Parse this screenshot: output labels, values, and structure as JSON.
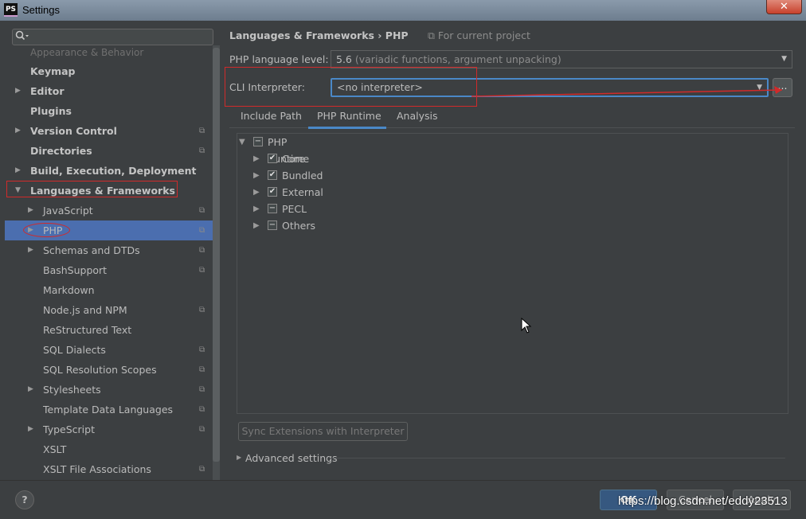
{
  "window": {
    "title": "Settings",
    "logo_text": "PS",
    "close_glyph": "✕"
  },
  "search": {
    "icon": "search-icon",
    "placeholder": ""
  },
  "sidebar": {
    "faded_item": "Appearance & Behavior",
    "items": [
      {
        "label": "Keymap",
        "bold": true,
        "arrow": "",
        "project": false
      },
      {
        "label": "Editor",
        "bold": true,
        "arrow": "▶",
        "project": false
      },
      {
        "label": "Plugins",
        "bold": true,
        "arrow": "",
        "project": false
      },
      {
        "label": "Version Control",
        "bold": true,
        "arrow": "▶",
        "project": true
      },
      {
        "label": "Directories",
        "bold": true,
        "arrow": "",
        "project": true
      },
      {
        "label": "Build, Execution, Deployment",
        "bold": true,
        "arrow": "▶",
        "project": false
      },
      {
        "label": "Languages & Frameworks",
        "bold": true,
        "arrow": "▼",
        "project": false
      },
      {
        "label": "JavaScript",
        "bold": false,
        "arrow": "▶",
        "project": true
      },
      {
        "label": "PHP",
        "bold": false,
        "arrow": "▶",
        "project": true,
        "selected": true
      },
      {
        "label": "Schemas and DTDs",
        "bold": false,
        "arrow": "▶",
        "project": true
      },
      {
        "label": "BashSupport",
        "bold": false,
        "arrow": "",
        "project": true
      },
      {
        "label": "Markdown",
        "bold": false,
        "arrow": "",
        "project": false
      },
      {
        "label": "Node.js and NPM",
        "bold": false,
        "arrow": "",
        "project": true
      },
      {
        "label": "ReStructured Text",
        "bold": false,
        "arrow": "",
        "project": false
      },
      {
        "label": "SQL Dialects",
        "bold": false,
        "arrow": "",
        "project": true
      },
      {
        "label": "SQL Resolution Scopes",
        "bold": false,
        "arrow": "",
        "project": true
      },
      {
        "label": "Stylesheets",
        "bold": false,
        "arrow": "▶",
        "project": true
      },
      {
        "label": "Template Data Languages",
        "bold": false,
        "arrow": "",
        "project": true
      },
      {
        "label": "TypeScript",
        "bold": false,
        "arrow": "▶",
        "project": true
      },
      {
        "label": "XSLT",
        "bold": false,
        "arrow": "",
        "project": false
      },
      {
        "label": "XSLT File Associations",
        "bold": false,
        "arrow": "",
        "project": true
      }
    ]
  },
  "header": {
    "breadcrumb": "Languages & Frameworks  ›  PHP",
    "scope_hint": "⧉ For current project"
  },
  "php_level": {
    "label": "PHP language level:",
    "version": "5.6",
    "description": "(variadic functions, argument unpacking)"
  },
  "cli": {
    "label": "CLI Interpreter:",
    "value": "<no interpreter>",
    "browse_label": "..."
  },
  "tabs": [
    {
      "label": "Include Path",
      "active": false
    },
    {
      "label": "PHP Runtime",
      "active": true
    },
    {
      "label": "Analysis",
      "active": false
    }
  ],
  "runtime": {
    "root": {
      "label": "PHP Runtime",
      "state": "partial"
    },
    "children": [
      {
        "label": "Core",
        "state": "checked"
      },
      {
        "label": "Bundled",
        "state": "checked"
      },
      {
        "label": "External",
        "state": "checked"
      },
      {
        "label": "PECL",
        "state": "partial"
      },
      {
        "label": "Others",
        "state": "partial"
      }
    ]
  },
  "sync_button": "Sync Extensions with Interpreter",
  "advanced": "Advanced settings",
  "footer": {
    "help": "?",
    "ok": "OK",
    "cancel": "Cancel",
    "apply": "Apply"
  },
  "watermark": "https://blog.csdn.net/eddy23513",
  "colors": {
    "accent": "#4a88c7",
    "selection": "#4b6eaf",
    "annotation": "#d12a2a",
    "background": "#3c3f41"
  }
}
